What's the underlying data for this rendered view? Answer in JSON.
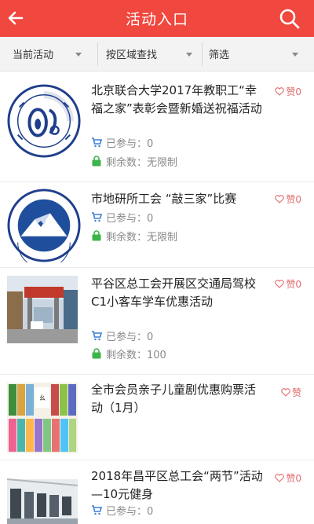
{
  "header": {
    "title": "活动入口"
  },
  "filters": [
    {
      "label": "当前活动"
    },
    {
      "label": "按区域查找"
    },
    {
      "label": "筛选"
    }
  ],
  "items": [
    {
      "title": "北京联合大学2017年教职工“幸福之家”表彰会暨新婚送祝福活动",
      "participated": "已参与：0",
      "remaining": "剩余数：无限制",
      "like": "赞0",
      "thumb": "beijing-union-university-logo"
    },
    {
      "title": "市地研所工会 “敲三家”比赛",
      "participated": "已参与：0",
      "remaining": "剩余数：无限制",
      "like": "赞0",
      "thumb": "institute-mountain-logo"
    },
    {
      "title": "平谷区总工会开展区交通局驾校C1小客车学车优惠活动",
      "participated": "已参与：0",
      "remaining": "剩余数：100",
      "like": "赞0",
      "thumb": "driving-school-photo"
    },
    {
      "title": "全市会员亲子儿童剧优惠购票活动（1月）",
      "like": "赞",
      "thumb": "children-drama-posters"
    },
    {
      "title": "2018年昌平区总工会“两节”活动—10元健身",
      "participated": "已参与：0",
      "like": "赞0",
      "thumb": "gym-photo"
    }
  ],
  "colors": {
    "brand_red": "#f0473e",
    "cart_blue": "#3b7fd6",
    "lock_green": "#3cb54a",
    "like_red": "#e26b6b"
  }
}
